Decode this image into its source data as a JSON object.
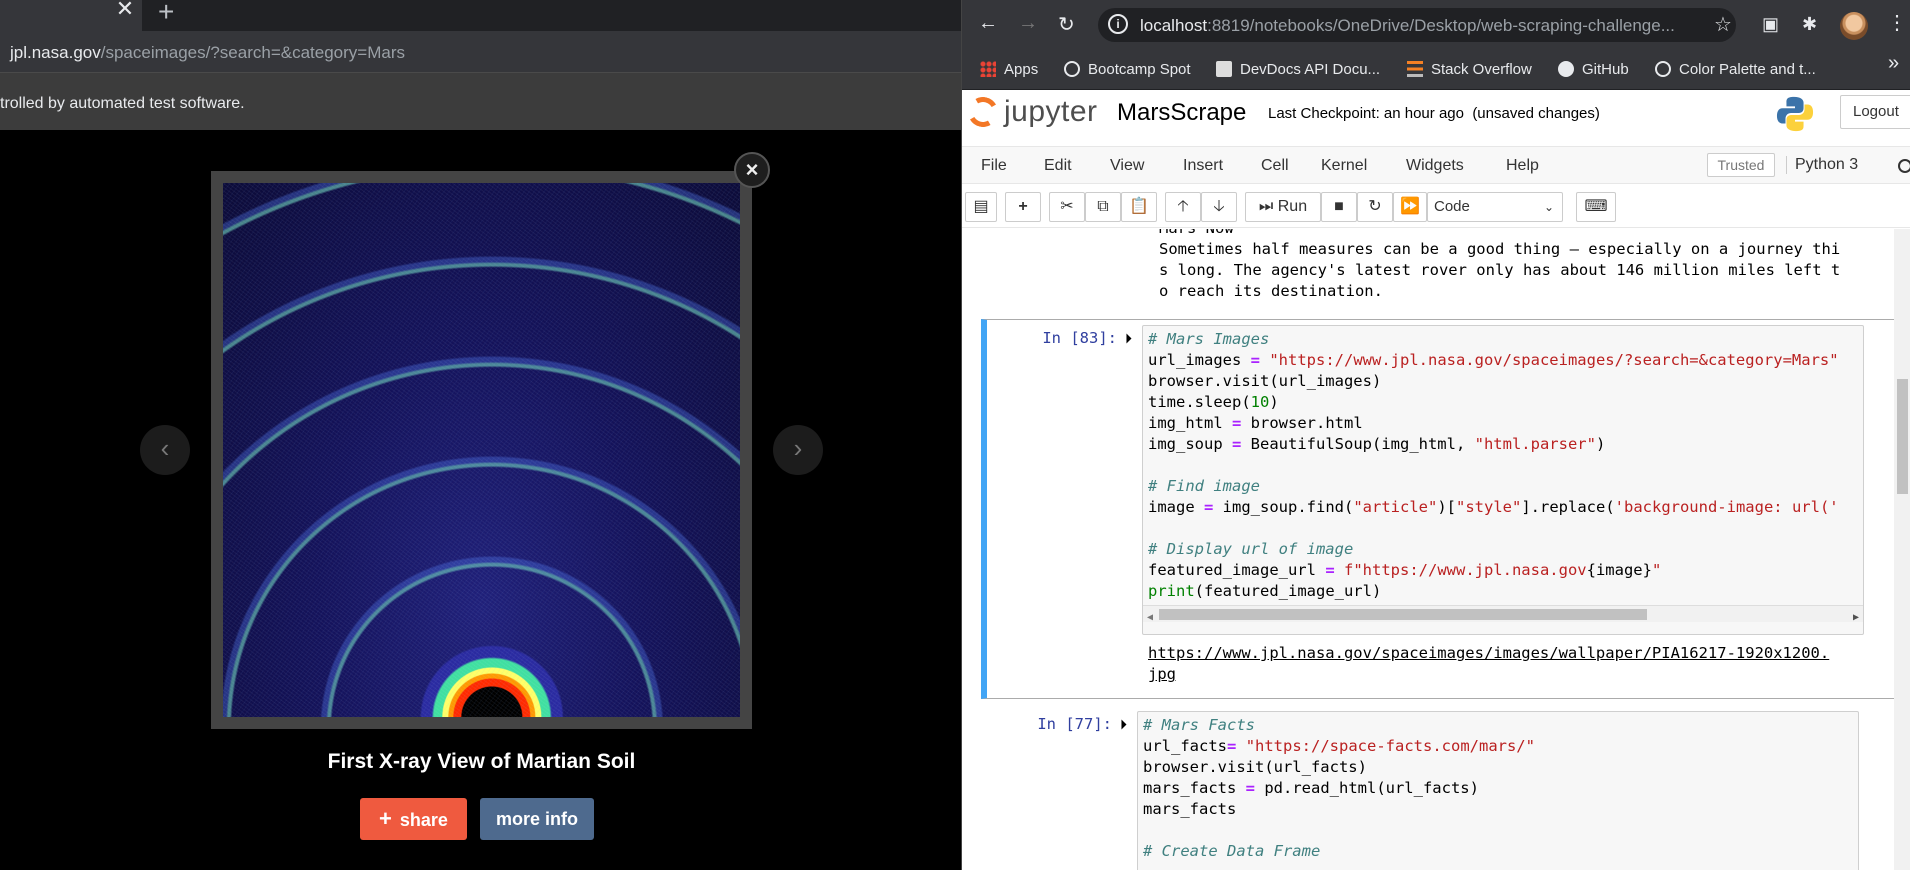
{
  "left_browser": {
    "tab_close": "✕",
    "new_tab": "+",
    "url_host": "jpl.nasa.gov",
    "url_path": "/spaceimages/?search=&category=Mars",
    "infobar_text": "trolled by automated test software."
  },
  "lightbox": {
    "close": "×",
    "prev": "‹",
    "next": "›",
    "image_title": "First X-ray View of Martian Soil",
    "share_label": "share",
    "share_icon": "+",
    "more_info_label": "more info"
  },
  "right_browser": {
    "url_host": "localhost",
    "url_path": ":8819/notebooks/OneDrive/Desktop/web-scraping-challenge...",
    "bookmarks": [
      "Apps",
      "Bootcamp Spot",
      "DevDocs API Docu...",
      "Stack Overflow",
      "GitHub",
      "Color Palette and t..."
    ],
    "more": "»"
  },
  "jupyter": {
    "logo_text": "jupyter",
    "notebook_name": "MarsScrape",
    "checkpoint": "Last Checkpoint: an hour ago",
    "unsaved": "(unsaved changes)",
    "logout": "Logout",
    "menu": [
      "File",
      "Edit",
      "View",
      "Insert",
      "Cell",
      "Kernel",
      "Widgets",
      "Help"
    ],
    "trusted": "Trusted",
    "kernel_name": "Python 3",
    "toolbar": {
      "run_label": "Run",
      "cell_type": "Code"
    }
  },
  "notebook": {
    "prev_output": "Mars Now\nSometimes half measures can be a good thing – especially on a journey thi\ns long. The agency's latest rover only has about 146 million miles left t\no reach its destination.",
    "cell_83": {
      "prompt": "In [83]:",
      "output": "https://www.jpl.nasa.gov/spaceimages/images/wallpaper/PIA16217-1920x1200.\njpg"
    },
    "cell_77": {
      "prompt": "In [77]:"
    }
  }
}
